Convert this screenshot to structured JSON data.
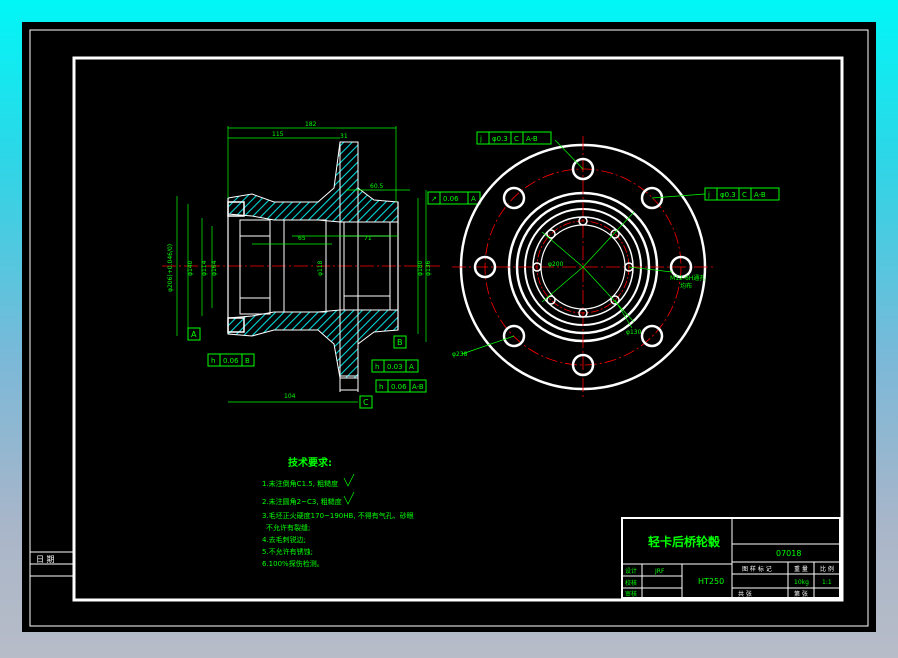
{
  "title_block": {
    "part_name": "轻卡后桥轮毂",
    "drawing_number": "07018",
    "material": "HT250",
    "row_labels": [
      "设计",
      "校核",
      "审核"
    ],
    "designer": "JRF",
    "header_cells": [
      "图 样 标 记",
      "重 量",
      "比 例"
    ],
    "weight": "10kg",
    "scale": "1:1",
    "sheet_cells": [
      "共  张",
      "第  张"
    ],
    "left_stamp": "日 期"
  },
  "technical_requirements": {
    "heading": "技术要求:",
    "items": [
      "1.未注倒角C1.5, 粗糙度",
      "2.未注圆角2~C3, 粗糙度",
      "3.毛坯正火硬度170~190HB, 不得有气孔、砂眼",
      "不允许有裂缝;",
      "4.去毛刺锐边;",
      "5.不允许有锈蚀;",
      "6.100%探伤检测。"
    ]
  },
  "section_view": {
    "dimensions": [
      "182",
      "115",
      "31",
      "60.5",
      "65",
      "104",
      "71",
      "φ114",
      "φ140",
      "φ164",
      "φ180",
      "φ206(+0.046/0)",
      "φ136",
      "φ118"
    ],
    "datums": [
      "A",
      "B",
      "C"
    ],
    "tolerance_frames": [
      {
        "symbol": "↗",
        "value": "0.06",
        "datum": "A"
      },
      {
        "symbol": "h",
        "value": "0.06",
        "datum": "B"
      },
      {
        "symbol": "h",
        "value": "0.03",
        "datum": "A"
      },
      {
        "symbol": "h",
        "value": "0.06",
        "datum": "A-B"
      }
    ]
  },
  "front_view": {
    "position_frames": [
      {
        "symbol": "j",
        "value": "φ0.3",
        "datum1": "C",
        "datum2": "A-B"
      },
      {
        "symbol": "j",
        "value": "φ0.3",
        "datum1": "C",
        "datum2": "A-B"
      }
    ],
    "labels": [
      "M12-6H通孔",
      "均布",
      "φ130",
      "φ238",
      "φ200"
    ]
  },
  "colors": {
    "line": "#ffffff",
    "dimension": "#00ff00",
    "center": "#ff0000",
    "hatch": "#00d8d8"
  }
}
